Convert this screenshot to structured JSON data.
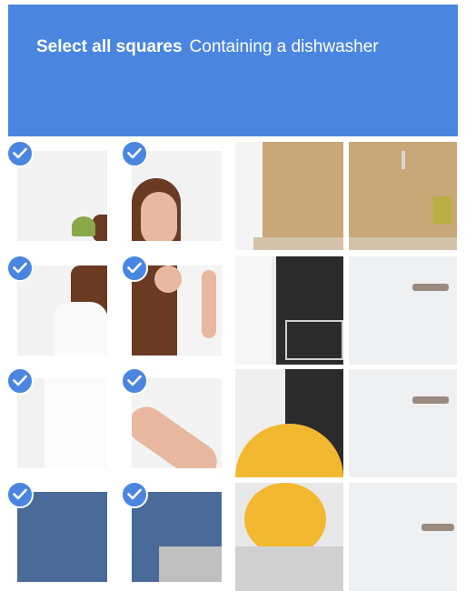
{
  "header": {
    "title_bold": "Select all squares",
    "title_rest": "Containing a dishwasher"
  },
  "colors": {
    "accent": "#4a86e0",
    "cabinet_wood": "#c8a878",
    "cabinet_white": "#eef0f2",
    "counter": "#d4c2a8",
    "hair": "#6a3a22",
    "skin": "#e8b8a0",
    "jeans": "#4a6a9a",
    "dishwasher_dark": "#2b2b2b",
    "plate_yellow": "#f2b830"
  },
  "tiles": [
    {
      "row": 1,
      "col": 1,
      "selected": true,
      "content": "wall"
    },
    {
      "row": 1,
      "col": 2,
      "selected": true,
      "content": "woman-head"
    },
    {
      "row": 1,
      "col": 3,
      "selected": false,
      "content": "kitchen-top"
    },
    {
      "row": 1,
      "col": 4,
      "selected": false,
      "content": "cabinet-wood"
    },
    {
      "row": 2,
      "col": 1,
      "selected": true,
      "content": "woman-back"
    },
    {
      "row": 2,
      "col": 2,
      "selected": true,
      "content": "woman-face-hand"
    },
    {
      "row": 2,
      "col": 3,
      "selected": false,
      "content": "dishwasher-door"
    },
    {
      "row": 2,
      "col": 4,
      "selected": false,
      "content": "cabinet-drawer"
    },
    {
      "row": 3,
      "col": 1,
      "selected": true,
      "content": "woman-shirt"
    },
    {
      "row": 3,
      "col": 2,
      "selected": true,
      "content": "woman-arm"
    },
    {
      "row": 3,
      "col": 3,
      "selected": false,
      "content": "dishwasher-rack"
    },
    {
      "row": 3,
      "col": 4,
      "selected": false,
      "content": "cabinet-drawer"
    },
    {
      "row": 4,
      "col": 1,
      "selected": true,
      "content": "jeans"
    },
    {
      "row": 4,
      "col": 2,
      "selected": true,
      "content": "jeans-rack"
    },
    {
      "row": 4,
      "col": 3,
      "selected": false,
      "content": "plates"
    },
    {
      "row": 4,
      "col": 4,
      "selected": false,
      "content": "cabinet-bottom"
    }
  ]
}
